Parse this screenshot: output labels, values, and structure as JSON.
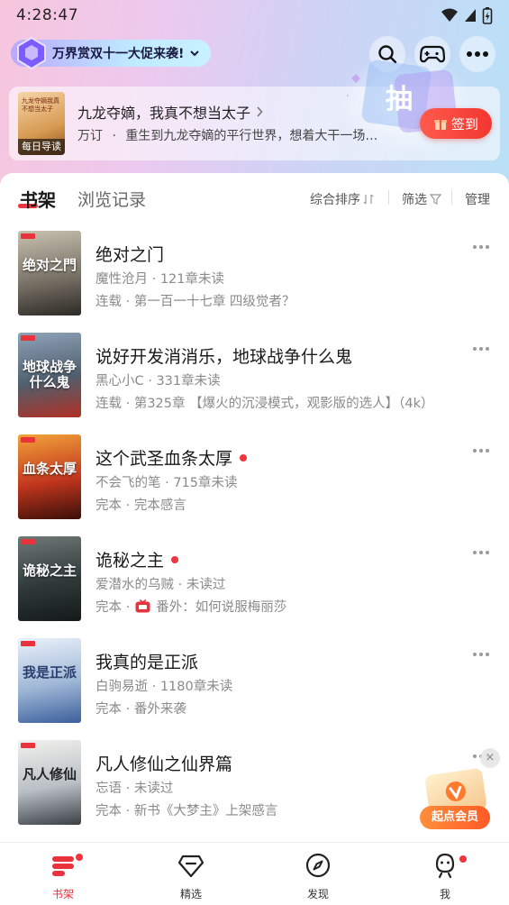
{
  "status_bar": {
    "time": "4:28:47"
  },
  "header": {
    "promo_text": "万界赏双十一大促来袭!",
    "lottery_text": "抽"
  },
  "daily": {
    "cover_tag": "每日导读",
    "cover_title": "九龙夺嫡我真不想当太子",
    "title": "九龙夺嫡，我真不想当太子",
    "author": "万订",
    "separator": "·",
    "summary": "重生到九龙夺嫡的平行世界，想着大干一场…",
    "checkin_label": "签到"
  },
  "tabs": {
    "shelf": "书架",
    "history": "浏览记录",
    "sort": "综合排序",
    "filter": "筛选",
    "manage": "管理"
  },
  "books": [
    {
      "title": "绝对之门",
      "cover_text": "绝对之門",
      "meta": "魔性沧月 · 121章未读",
      "status": "连载 · 第一百一十七章 四级觉者？",
      "new": false,
      "cover_colors": [
        "#c9c1b0",
        "#7b7468",
        "#2c2a26"
      ]
    },
    {
      "title": "说好开发消消乐，地球战争什么鬼",
      "cover_text": "地球战争什么鬼",
      "meta": "黑心小C · 331章未读",
      "status": "连载 · 第325章 【爆火的沉浸模式，观影版的选人】（4k）",
      "new": false,
      "cover_colors": [
        "#8fa3b8",
        "#4f5f6e",
        "#b03024"
      ]
    },
    {
      "title": "这个武圣血条太厚",
      "cover_text": "血条太厚",
      "meta": "不会飞的笔 · 715章未读",
      "status": "完本 · 完本感言",
      "new": true,
      "cover_colors": [
        "#f2a33a",
        "#c2361e",
        "#3a0f08"
      ]
    },
    {
      "title": "诡秘之主",
      "cover_text": "诡秘之主",
      "meta": "爱潜水的乌贼 · 未读过",
      "status_prefix": "完本 ·",
      "status_suffix": "番外：如何说服梅丽莎",
      "new": true,
      "cover_colors": [
        "#6f7a78",
        "#2f3a38",
        "#141a19"
      ]
    },
    {
      "title": "我真的是正派",
      "cover_text": "我是正派",
      "meta": "白驹易逝 · 1180章未读",
      "status": "完本 · 番外来袭",
      "new": false,
      "cover_colors": [
        "#eaf1fb",
        "#9fb7d6",
        "#3b5f9c"
      ]
    },
    {
      "title": "凡人修仙之仙界篇",
      "cover_text": "凡人修仙",
      "meta": "忘语 · 未读过",
      "status": "完本 · 新书《大梦主》上架感言",
      "new": false,
      "cover_colors": [
        "#f2f2ee",
        "#b9bfc4",
        "#3a3f44"
      ]
    }
  ],
  "vip": {
    "label": "起点会员",
    "close": "×"
  },
  "nav": {
    "shelf": "书架",
    "featured": "精选",
    "discover": "发现",
    "me": "我"
  },
  "colors": {
    "accent": "#f0353e",
    "checkin": "#f2372f"
  }
}
